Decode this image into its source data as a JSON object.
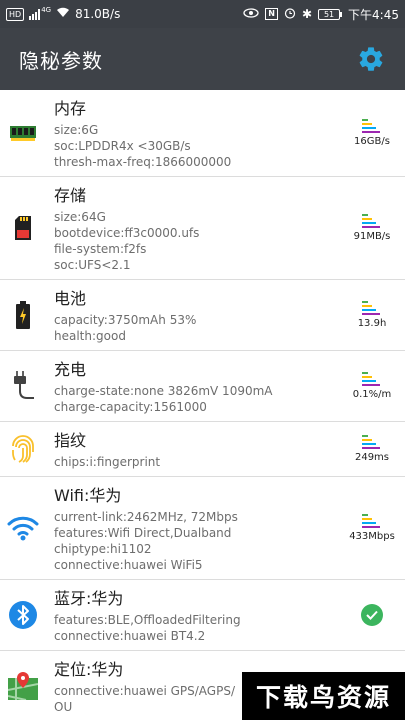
{
  "status_bar": {
    "hd": "HD",
    "network": "4G",
    "speed": "81.0B/s",
    "battery": "51",
    "time": "下午4:45"
  },
  "app_bar": {
    "title": "隐秘参数",
    "settings_icon": "gear-icon",
    "accent": "#29a8e0"
  },
  "items": [
    {
      "title": "内存",
      "icon": "ram-icon",
      "lines": [
        "size:6G",
        "soc:LPDDR4x <30GB/s",
        "thresh-max-freq:1866000000"
      ],
      "metric": "16GB/s"
    },
    {
      "title": "存储",
      "icon": "sd-card-icon",
      "lines": [
        "size:64G",
        "bootdevice:ff3c0000.ufs",
        "file-system:f2fs",
        "soc:UFS<2.1"
      ],
      "metric": "91MB/s"
    },
    {
      "title": "电池",
      "icon": "battery-icon",
      "lines": [
        "capacity:3750mAh 53%",
        "health:good"
      ],
      "metric": "13.9h"
    },
    {
      "title": "充电",
      "icon": "charger-plug-icon",
      "lines": [
        "charge-state:none 3826mV 1090mA",
        "charge-capacity:1561000"
      ],
      "metric": "0.1%/m"
    },
    {
      "title": "指纹",
      "icon": "fingerprint-icon",
      "lines": [
        "chips:i:fingerprint"
      ],
      "metric": "249ms"
    },
    {
      "title": "Wifi:华为",
      "icon": "wifi-icon",
      "lines": [
        "current-link:2462MHz, 72Mbps",
        "features:Wifi Direct,Dualband",
        "chiptype:hi1102",
        "connective:huawei WiFi5"
      ],
      "metric": "433Mbps"
    },
    {
      "title": "蓝牙:华为",
      "icon": "bluetooth-icon",
      "lines": [
        "features:BLE,OffloadedFiltering",
        "connective:huawei BT4.2"
      ],
      "status_icon": "check-icon"
    },
    {
      "title": "定位:华为",
      "icon": "map-location-icon",
      "lines": [
        "connective:huawei GPS/AGPS/",
        "OU"
      ]
    }
  ],
  "bar_colors": [
    "#4caf50",
    "#ffc107",
    "#03a9f4",
    "#9c27b0"
  ],
  "watermark": "下载鸟资源"
}
